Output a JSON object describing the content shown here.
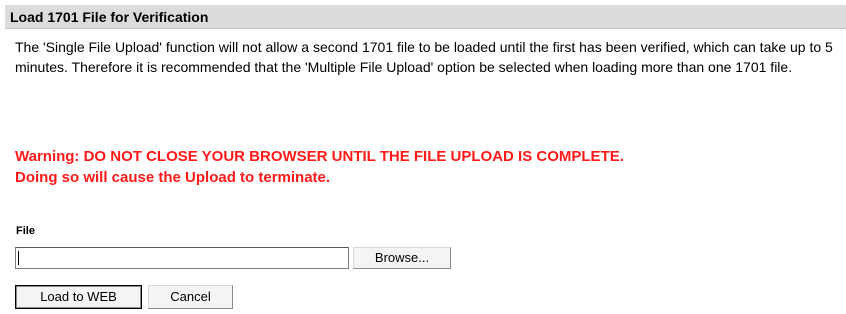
{
  "header": {
    "title": "Load 1701 File for Verification"
  },
  "intro": {
    "text": "The 'Single File Upload' function will not allow a second 1701 file to be loaded until the first has been verified, which can take up to 5 minutes. Therefore it is recommended that the 'Multiple File Upload' option be selected when loading more than one 1701 file."
  },
  "warning": {
    "line1": "Warning: DO NOT CLOSE YOUR BROWSER UNTIL THE FILE UPLOAD IS COMPLETE.",
    "line2": "Doing so will cause the Upload to terminate.",
    "color": "#ff1a1a"
  },
  "file_field": {
    "label": "File",
    "value": "",
    "browse_label": "Browse..."
  },
  "actions": {
    "load_label": "Load to WEB",
    "cancel_label": "Cancel"
  }
}
